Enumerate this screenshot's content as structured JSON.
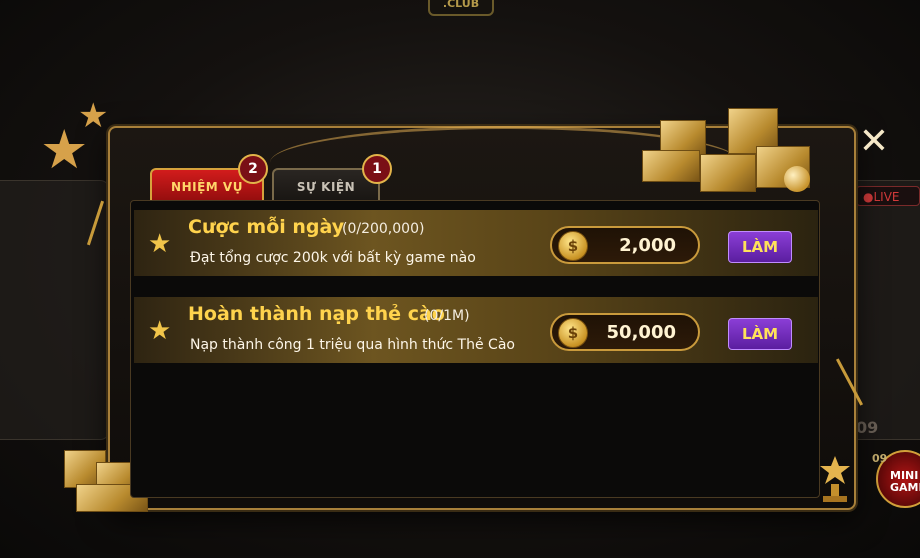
{
  "background": {
    "top_logo": ".CLUB",
    "live_badge": "LIVE",
    "side_number": "09",
    "mini_game_label": "MINI GAME",
    "mini_game_count": "09"
  },
  "tabs": [
    {
      "label": "NHIỆM VỤ",
      "badge": "2",
      "active": true
    },
    {
      "label": "SỰ KIỆN",
      "badge": "1",
      "active": false
    }
  ],
  "missions": [
    {
      "title": "Cược mỗi ngày",
      "progress": "(0/200,000)",
      "description": "Đạt tổng cược 200k với bất kỳ game nào",
      "reward": "2,000",
      "button": "LÀM",
      "icon": "star-icon"
    },
    {
      "title": "Hoàn thành nạp thẻ cào",
      "progress": "(0/1M)",
      "description": "Nạp thành công 1 triệu qua hình thức Thẻ Cào",
      "reward": "50,000",
      "button": "LÀM",
      "icon": "star-icon"
    }
  ],
  "coin_symbol": "$",
  "close_icon": "close-icon",
  "colors": {
    "gold": "#ffd34d",
    "active_tab": "#d21c1c",
    "button": "#8b3ed6",
    "button_text": "#ffe25a"
  }
}
